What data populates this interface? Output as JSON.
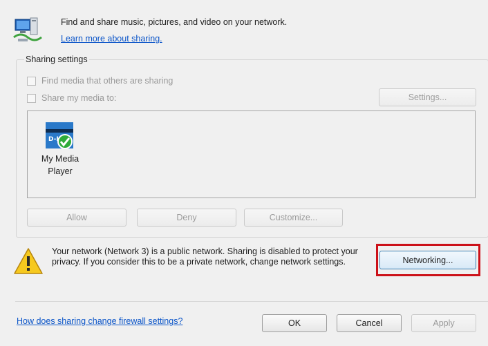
{
  "header": {
    "description": "Find and share music, pictures, and video on your network.",
    "learn_more_link": "Learn more about sharing."
  },
  "sharing_settings": {
    "title": "Sharing settings",
    "find_media_label": "Find media that others are sharing",
    "share_media_label": "Share my media to:",
    "settings_button": "Settings...",
    "device": {
      "name_line1": "My Media",
      "name_line2": "Player",
      "icon": "media-player-device-icon"
    },
    "allow_button": "Allow",
    "deny_button": "Deny",
    "customize_button": "Customize..."
  },
  "warning": {
    "icon": "warning-icon",
    "text": "Your network (Network  3) is a public network. Sharing is disabled to protect your privacy. If you consider this to be a private network, change network settings.",
    "networking_button": "Networking..."
  },
  "footer": {
    "firewall_link": "How does sharing change firewall settings?",
    "ok_button": "OK",
    "cancel_button": "Cancel",
    "apply_button": "Apply"
  },
  "colors": {
    "highlight": "#cc1119",
    "link": "#0a54c8"
  }
}
